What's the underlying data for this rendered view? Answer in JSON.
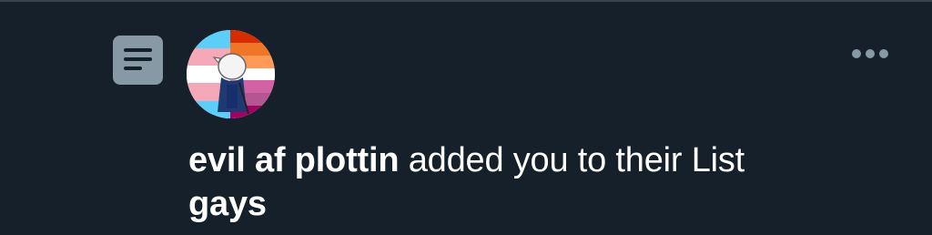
{
  "notification": {
    "type_icon": "list-icon",
    "avatar_icon": "user-avatar",
    "more_icon": "more-options-icon",
    "user_name": "evil af plottin",
    "action": " added you to their List",
    "list_name": "gays"
  },
  "colors": {
    "background": "#15202b",
    "icon_bg": "#8899a6",
    "text": "#ffffff"
  }
}
